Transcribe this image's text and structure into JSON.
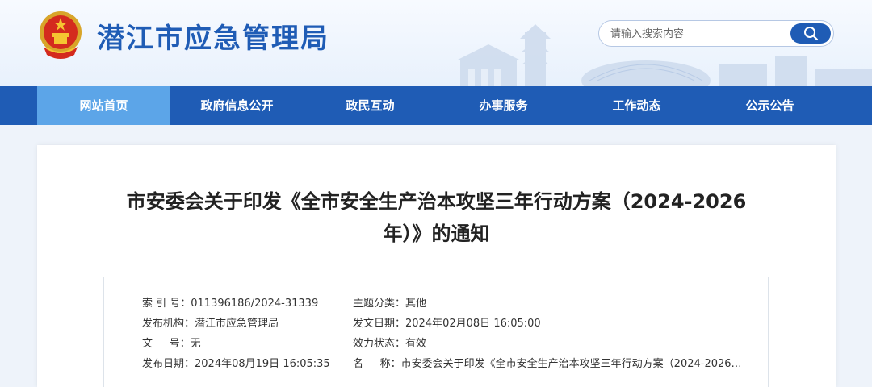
{
  "header": {
    "site_title": "潜江市应急管理局",
    "search_placeholder": "请输入搜索内容"
  },
  "nav": {
    "items": [
      {
        "label": "网站首页"
      },
      {
        "label": "政府信息公开"
      },
      {
        "label": "政民互动"
      },
      {
        "label": "办事服务"
      },
      {
        "label": "工作动态"
      },
      {
        "label": "公示公告"
      }
    ]
  },
  "article": {
    "title_line1": "市安委会关于印发《全市安全生产治本攻坚三年行动方案（2024-2026",
    "title_line2": "年）》的通知"
  },
  "meta": {
    "index_label": "索 引 号：",
    "index_value": "011396186/2024-31339",
    "category_label": "主题分类：",
    "category_value": "其他",
    "org_label": "发布机构：",
    "org_value": "潜江市应急管理局",
    "issue_date_label": "发文日期：",
    "issue_date_value": "2024年02月08日 16:05:00",
    "doc_no_label": "文     号：",
    "doc_no_value": "无",
    "status_label": "效力状态：",
    "status_value": "有效",
    "publish_date_label": "发布日期：",
    "publish_date_value": "2024年08月19日 16:05:35",
    "name_label": "名     称：",
    "name_value": "市安委会关于印发《全市安全生产治本攻坚三年行动方案（2024-2026年..."
  },
  "colors": {
    "brand_blue": "#1f5cb5",
    "nav_active": "#5ca5e8"
  }
}
